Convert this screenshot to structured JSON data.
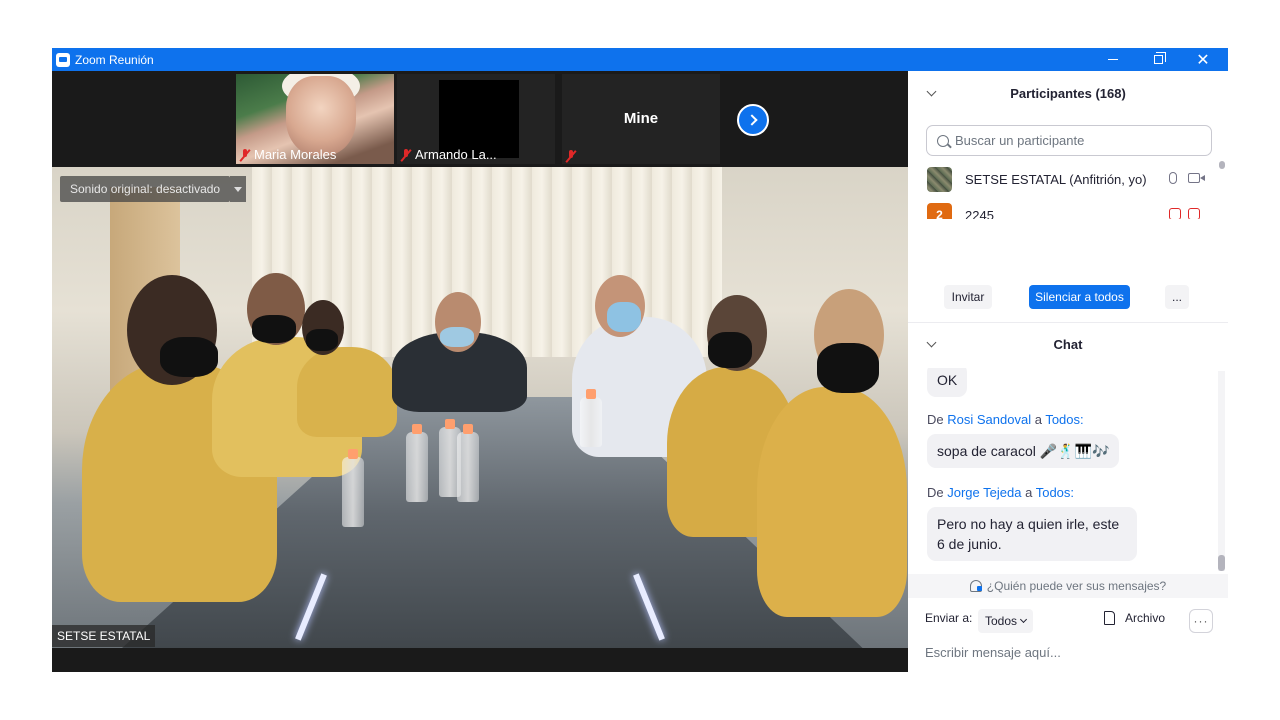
{
  "window": {
    "title": "Zoom Reunión",
    "minimize_label": "",
    "restore_label": "",
    "close_label": "✕"
  },
  "gallery": {
    "thumbnails": [
      {
        "name": "Maria Morales",
        "muted": true
      },
      {
        "name": "Armando La...",
        "muted": true
      },
      {
        "name": "",
        "label": "Mine",
        "muted": true
      }
    ],
    "next_icon": "chevron-right-icon"
  },
  "main_video": {
    "original_sound": "Sonido original: desactivado",
    "speaker_name": "SETSE ESTATAL"
  },
  "participants": {
    "header": "Participantes (168)",
    "search_placeholder": "Buscar un participante",
    "list": [
      {
        "name": "SETSE ESTATAL (Anfitrión, yo)",
        "avatar": "",
        "mic": "on",
        "video": "on"
      },
      {
        "name": "2245",
        "avatar": "2",
        "mic": "off",
        "video": "off"
      }
    ],
    "buttons": {
      "invite": "Invitar",
      "mute_all": "Silenciar a todos",
      "more": "..."
    }
  },
  "chat": {
    "header": "Chat",
    "messages": [
      {
        "text": "OK"
      },
      {
        "prefix": "De",
        "from": "Rosi Sandoval",
        "to_prefix": "a",
        "to": "Todos:",
        "text": "sopa de caracol 🎤🕺🎹🎶"
      },
      {
        "prefix": "De",
        "from": "Jorge Tejeda",
        "to_prefix": "a",
        "to": "Todos:",
        "text": "Pero no hay a quien irle, este 6 de junio."
      }
    ],
    "who_can_see": "¿Quién puede ver sus mensajes?",
    "send_to_label": "Enviar a:",
    "send_to_value": "Todos",
    "file_label": "Archivo",
    "more_label": "···",
    "input_placeholder": "Escribir mensaje aquí..."
  },
  "colors": {
    "accent": "#0e72ed",
    "muted_red": "#e02828",
    "avatar_orange": "#e06a11"
  }
}
